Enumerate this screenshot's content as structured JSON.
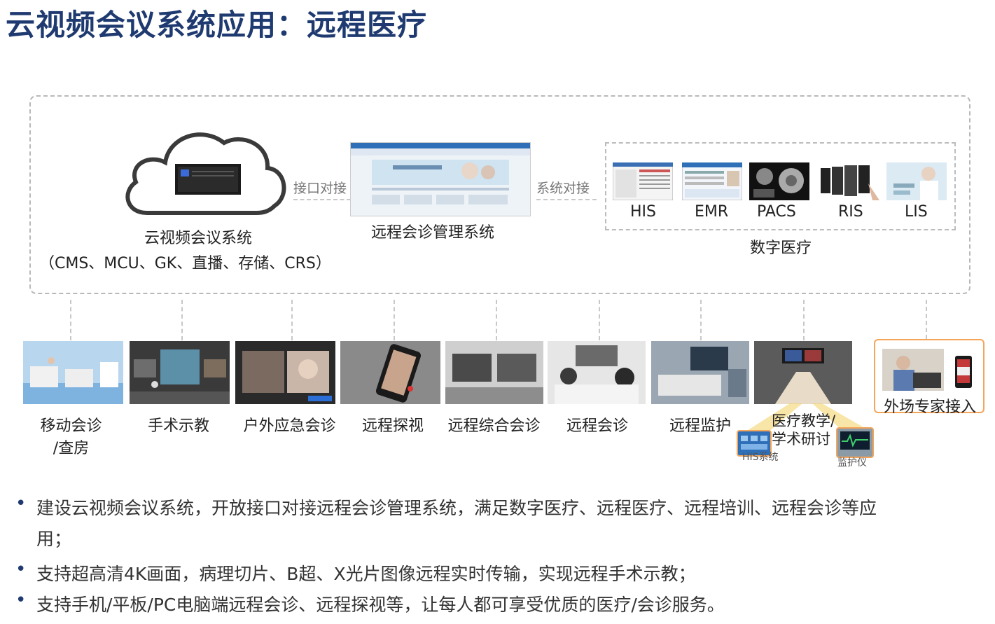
{
  "title": "云视频会议系统应用：远程医疗",
  "diagram": {
    "cloud_label_line1": "云视频会议系统",
    "cloud_label_line2": "（CMS、MCU、GK、直播、存储、CRS）",
    "interface_link": "接口对接",
    "mgmt_label": "远程会诊管理系统",
    "system_link": "系统对接",
    "digital_label": "数字医疗",
    "digital_items": [
      "HIS",
      "EMR",
      "PACS",
      "RIS",
      "LIS"
    ],
    "applications": [
      {
        "line1": "移动会诊",
        "line2": "/查房"
      },
      {
        "line1": "手术示教",
        "line2": ""
      },
      {
        "line1": "户外应急会诊",
        "line2": ""
      },
      {
        "line1": "远程探视",
        "line2": ""
      },
      {
        "line1": "远程综合会诊",
        "line2": ""
      },
      {
        "line1": "远程会诊",
        "line2": ""
      },
      {
        "line1": "远程监护",
        "line2": ""
      },
      {
        "line1": "医疗教学/",
        "line2": "学术研讨"
      }
    ],
    "expert_label": "外场专家接入",
    "sub_labels": {
      "his_system": "HIS系统",
      "monitor": "监护仪"
    }
  },
  "bullets": [
    {
      "line1": "建设云视频会议系统，开放接口对接远程会诊管理系统，满足数字医疗、远程医疗、远程培训、远程会诊等应",
      "line2": "用；"
    },
    {
      "line1": "支持超高清4K画面，病理切片、B超、X光片图像远程实时传输，实现远程手术示教；",
      "line2": ""
    },
    {
      "line1": "支持手机/平板/PC电脑端远程会诊、远程探视等，让每人都可享受优质的医疗/会诊服务。",
      "line2": ""
    }
  ],
  "colors": {
    "title": "#1f3a70",
    "accent_orange": "#f5a55a",
    "highlight_yellow": "#f2d060"
  }
}
